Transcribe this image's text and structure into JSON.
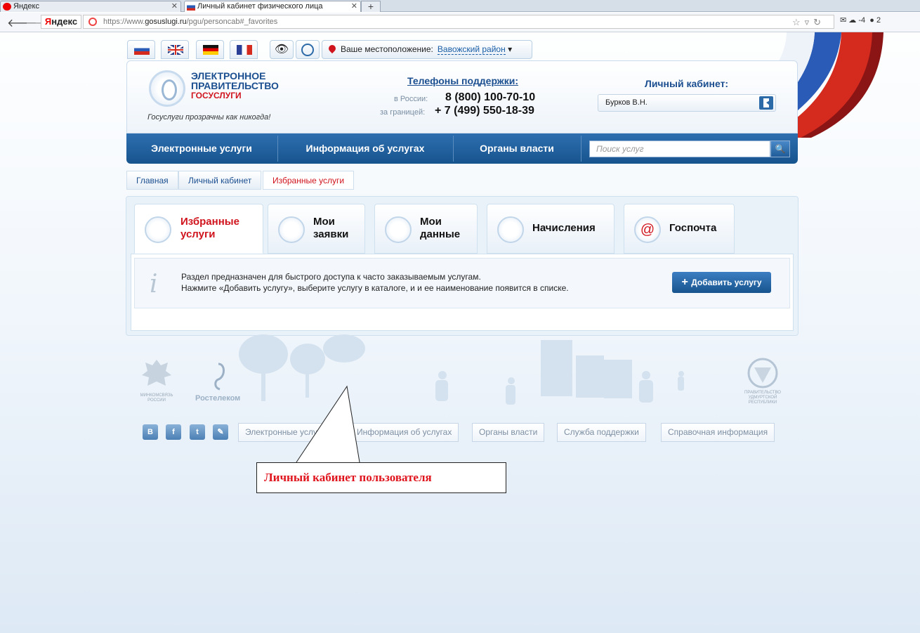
{
  "browser": {
    "tabs": [
      {
        "title": "Яндекс"
      },
      {
        "title": "Личный кабинет физического лица"
      }
    ],
    "url_prefix": "https://www.",
    "url_domain": "gosuslugi.ru",
    "url_path": "/pgu/personcab#_favorites",
    "yandex_logo_main": "ндекс",
    "yandex_logo_first": "Я",
    "weather": "-4",
    "notifications": "2"
  },
  "topbar": {
    "location_label": "Ваше местоположение:",
    "location_value": "Вавожский район"
  },
  "header": {
    "logo_line1": "ЭЛЕКТРОННОЕ",
    "logo_line2": "ПРАВИТЕЛЬСТВО",
    "logo_line3": "ГОСУСЛУГИ",
    "slogan": "Госуслуги прозрачны как никогда!",
    "phones_title": "Телефоны поддержки:",
    "phone_ru_label": "в России:",
    "phone_ru": "8 (800) 100-70-10",
    "phone_abroad_label": "за границей:",
    "phone_abroad": "+ 7 (499) 550-18-39",
    "cabinet_title": "Личный кабинет:",
    "user_name": "Бурков В.Н."
  },
  "nav": {
    "items": [
      "Электронные услуги",
      "Информация об услугах",
      "Органы власти"
    ],
    "search_placeholder": "Поиск услуг"
  },
  "breadcrumbs": [
    "Главная",
    "Личный кабинет",
    "Избранные услуги"
  ],
  "cabinet_tabs": [
    {
      "line1": "Избранные",
      "line2": "услуги"
    },
    {
      "line1": "Мои",
      "line2": "заявки"
    },
    {
      "line1": "Мои",
      "line2": "данные"
    },
    {
      "line1": "Начисления",
      "line2": ""
    },
    {
      "line1": "Госпочта",
      "line2": ""
    }
  ],
  "info": {
    "line1": "Раздел предназначен для быстрого доступа к часто заказываемым услугам.",
    "line2": "Нажмите «Добавить услугу», выберите услугу в каталоге, и и ее наименование появится в списке.",
    "add_button": "Добавить услугу"
  },
  "footer": {
    "minkom": "МИНКОМСВЯЗЬ РОССИИ",
    "rostelecom": "Ростелеком",
    "udmurt": "ПРАВИТЕЛЬСТВО УДМУРТСКОЙ РЕСПУБЛИКИ",
    "social": [
      "B",
      "f",
      "t",
      "✎"
    ],
    "links": [
      "Электронные услуги",
      "Информация об услугах",
      "Органы власти",
      "Служба поддержки",
      "Справочная информация"
    ]
  },
  "callout": "Личный кабинет пользователя",
  "colors": {
    "accent_blue": "#1b4f90",
    "accent_red": "#d0141d",
    "nav_blue": "#17548e"
  }
}
